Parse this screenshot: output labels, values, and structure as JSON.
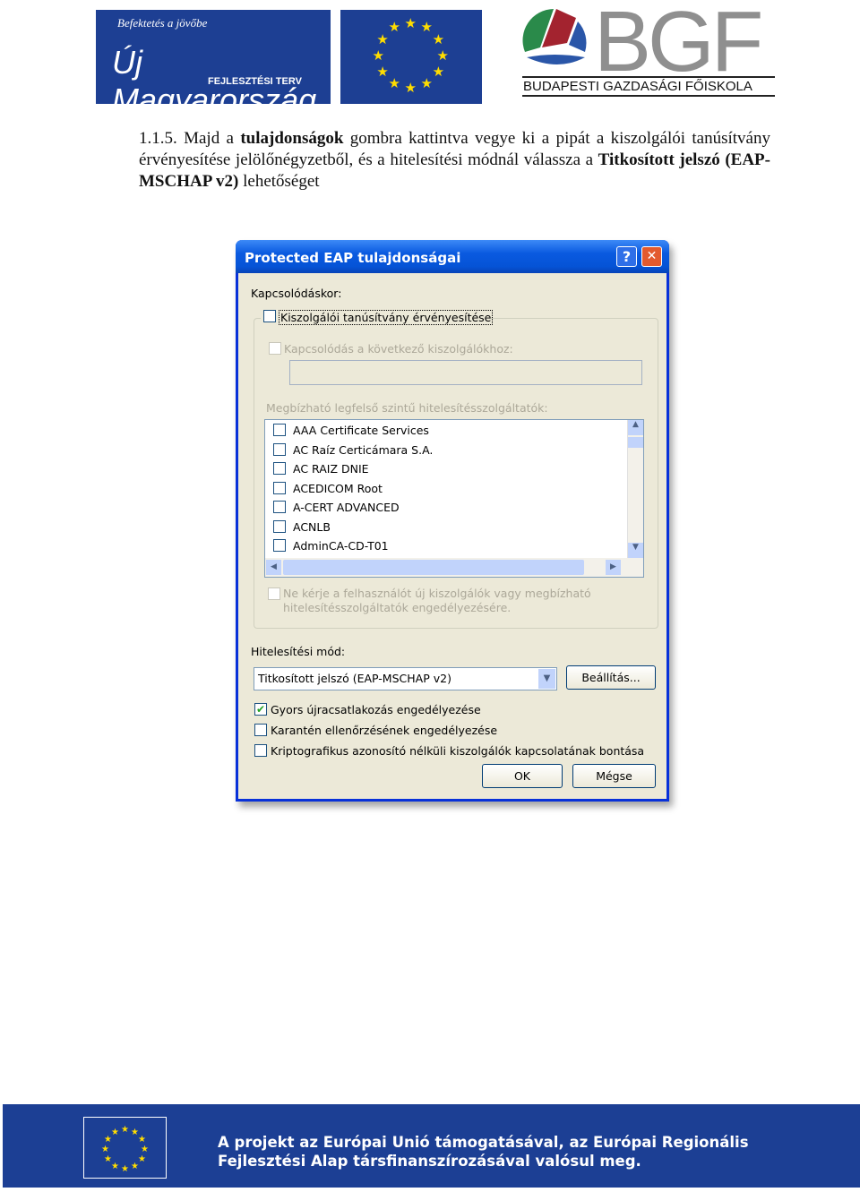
{
  "header": {
    "logo_left": {
      "tagline": "Befektetés a jövőbe",
      "name": "Új Magyarország",
      "sub": "FEJLESZTÉSI TERV"
    },
    "logo_eu": "EU flag",
    "logo_right": {
      "letters": "BGF",
      "name": "BUDAPESTI GAZDASÁGI FŐISKOLA"
    }
  },
  "instruction": {
    "number": "1.1.5.",
    "t1": " Majd a ",
    "b1": "tulajdonságok",
    "t2": " gombra kattintva vegye ki a pipát a kiszolgálói tanúsítvány érvényesítése jelölőnégyzetből, és a hitelesítési módnál válassza a ",
    "b2": "Titkosított jelszó (EAP-MSCHAP v2)",
    "t3": " lehetőséget"
  },
  "dialog": {
    "title": "Protected EAP tulajdonságai",
    "help": "?",
    "close": "✕",
    "connect_label": "Kapcsolódáskor:",
    "validate_cert": {
      "label": "Kiszolgálói tanúsítvány érvényesítése",
      "checked": false
    },
    "connect_servers": {
      "label": "Kapcsolódás a következő kiszolgálókhoz:",
      "checked": false,
      "value": ""
    },
    "trusted_label": "Megbízható legfelső szintű hitelesítésszolgáltatók:",
    "cas": [
      "AAA Certificate Services",
      "AC Raíz Certicámara S.A.",
      "AC RAIZ DNIE",
      "ACEDICOM Root",
      "A-CERT ADVANCED",
      "ACNLB",
      "AdminCA-CD-T01"
    ],
    "no_prompt": {
      "label1": "Ne kérje a felhasználót új kiszolgálók vagy megbízható",
      "label2": "hitelesítésszolgáltatók engedélyezésére.",
      "checked": false
    },
    "auth_label": "Hitelesítési mód:",
    "auth_value": "Titkosított jelszó (EAP-MSCHAP v2)",
    "settings": "Beállítás...",
    "options": [
      {
        "label": "Gyors újracsatlakozás engedélyezése",
        "checked": true
      },
      {
        "label": "Karantén ellenőrzésének engedélyezése",
        "checked": false
      },
      {
        "label": "Kriptografikus azonosító nélküli kiszolgálók kapcsolatának bontása",
        "checked": false
      }
    ],
    "ok": "OK",
    "cancel": "Mégse"
  },
  "footer": {
    "line1": "A projekt az Európai Unió támogatásával, az Európai Regionális",
    "line2": "Fejlesztési Alap társfinanszírozásával valósul meg."
  },
  "colors": {
    "eu_blue": "#1d3f93",
    "xp_title": "#0553d6",
    "dialog_bg": "#ECE9D8"
  }
}
